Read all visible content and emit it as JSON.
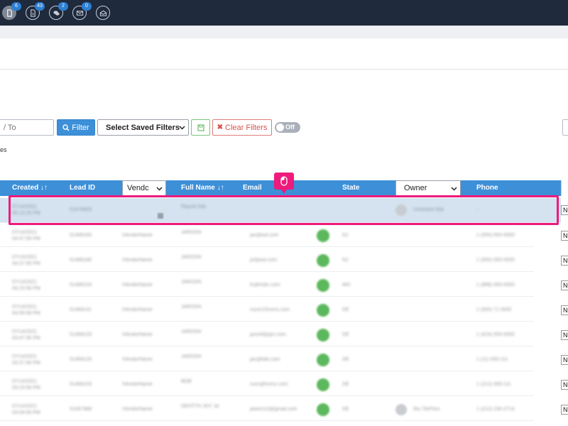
{
  "topbar": {
    "icons": [
      {
        "name": "documents-icon",
        "badge": "6"
      },
      {
        "name": "files-icon",
        "badge": "43"
      },
      {
        "name": "chat-icon",
        "badge": "2"
      },
      {
        "name": "mail-icon",
        "badge": "0"
      },
      {
        "name": "open-mail-icon",
        "badge": ""
      }
    ]
  },
  "filters": {
    "to_placeholder": "/ To",
    "filter_label": "Filter",
    "saved_filters_value": "Select Saved Filters",
    "clear_filters_label": "Clear Filters",
    "toggle_label": "Off",
    "truncated_text": "es"
  },
  "table": {
    "headers": {
      "created": "Created ↓↑",
      "lead_id": "Lead ID",
      "vendor_select": "Vendc",
      "full_name": "Full Name ↓↑",
      "email": "Email",
      "state": "State",
      "owner_select": "Owner",
      "phone": "Phone"
    },
    "rows": [
      {
        "created": "07/14/2021 05:13:25 PM",
        "lead_id": "01478403",
        "vendor": "",
        "full_name": "Placed Site",
        "email": "",
        "state": "",
        "owner": "Unlocked Site",
        "phone": "-",
        "status": false,
        "avatar": true,
        "end": "N"
      },
      {
        "created": "07/14/2021 04:47:59 PM",
        "lead_id": "01468183",
        "vendor": "IVendorName",
        "full_name": "JAROSN",
        "email": "jax@aol.com",
        "state": "NJ",
        "owner": "",
        "phone": "1 (000) 000-0000",
        "status": true,
        "avatar": false,
        "end": "N"
      },
      {
        "created": "07/14/2021 04:37:58 PM",
        "lead_id": "01468180",
        "vendor": "IVendorName",
        "full_name": "JAROSN",
        "email": "jsl@aol.com",
        "state": "NJ",
        "owner": "",
        "phone": "1 (000) 000-0000",
        "status": true,
        "avatar": false,
        "end": "N"
      },
      {
        "created": "07/14/2021 04:23:58 PM",
        "lead_id": "01468153",
        "vendor": "IVendorName",
        "full_name": "JAROSN",
        "email": "fc@hsbc.com",
        "state": "MO",
        "owner": "",
        "phone": "1 (888) 000-0000",
        "status": true,
        "avatar": false,
        "end": "N"
      },
      {
        "created": "07/14/2021 04:09:58 PM",
        "lead_id": "01468141",
        "vendor": "IVendorName",
        "full_name": "JAROSN",
        "email": "rucon15roms.com",
        "state": "DE",
        "owner": "",
        "phone": "1 (000) 71 0000",
        "status": true,
        "avatar": false,
        "end": "N"
      },
      {
        "created": "07/14/2021 03:47:56 PM",
        "lead_id": "01468133",
        "vendor": "IVendorName",
        "full_name": "JAROSN",
        "email": "jace4t@gm.com",
        "state": "DE",
        "owner": "",
        "phone": "1 (424) 000-0000",
        "status": true,
        "avatar": false,
        "end": "N"
      },
      {
        "created": "07/14/2021 03:37:56 PM",
        "lead_id": "01468120",
        "vendor": "IVendorName",
        "full_name": "JAROSN",
        "email": "jac@fakt.com",
        "state": "DE",
        "owner": "",
        "phone": "1 (11) 000-111",
        "status": true,
        "avatar": false,
        "end": "N"
      },
      {
        "created": "07/14/2021 03:23:56 PM",
        "lead_id": "01468103",
        "vendor": "IVendorName",
        "full_name": "BOB",
        "email": "runc@frumz.com",
        "state": "DE",
        "owner": "",
        "phone": "1 (212) 000-111",
        "status": true,
        "avatar": false,
        "end": "N"
      },
      {
        "created": "07/14/2021 03:09:56 PM",
        "lead_id": "01457988",
        "vendor": "IVendorName",
        "full_name": "DEHTTH JOY Jd",
        "email": "jawon11f@gmail.com",
        "state": "DE",
        "owner": "Rio TikPhes",
        "phone": "1 (212) 230-2714",
        "status": true,
        "avatar": true,
        "end": "N"
      }
    ]
  }
}
